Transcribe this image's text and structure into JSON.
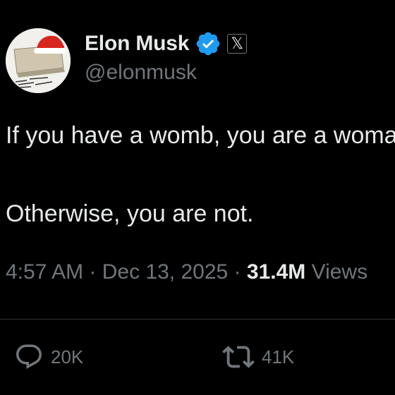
{
  "author": {
    "display_name": "Elon Musk",
    "handle": "@elonmusk",
    "verified": true,
    "verified_color": "#1d9bf0",
    "affiliation_badge": "𝕏",
    "avatar_icon": "santa-hat-icon"
  },
  "tweet": {
    "line1": "If you have a womb, you are a woman.",
    "line2": "Otherwise, you are not."
  },
  "meta": {
    "time": "4:57 AM",
    "separator": "·",
    "date": "Dec 13, 2025",
    "views_count": "31.4M",
    "views_label": "Views"
  },
  "actions": {
    "reply_icon": "reply-icon",
    "reply_count": "20K",
    "repost_icon": "repost-icon",
    "repost_count": "41K"
  },
  "colors": {
    "background": "#000000",
    "primary_text": "#e7e9ea",
    "secondary_text": "#71767b",
    "divider": "#2f3336"
  }
}
